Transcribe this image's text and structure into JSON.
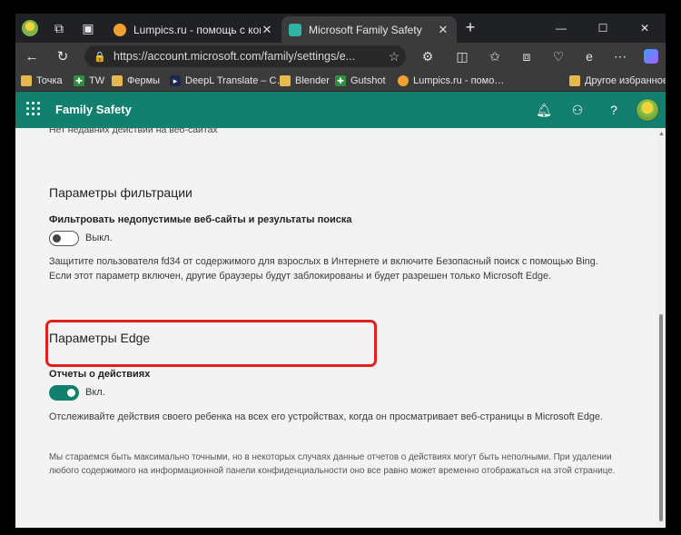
{
  "browser": {
    "tabs": [
      {
        "title": "Lumpics.ru - помощь с компьют…",
        "favicon_color": "#f0a030"
      },
      {
        "title": "Microsoft Family Safety",
        "favicon_color": "#2fb6a3"
      }
    ],
    "new_tab_label": "+",
    "address": "https://account.microsoft.com/family/settings/e...",
    "bookmarks": [
      {
        "label": "Точка",
        "icon": "folder-icon"
      },
      {
        "label": "TW",
        "icon": "bookmark-icon"
      },
      {
        "label": "Фермы",
        "icon": "folder-icon"
      },
      {
        "label": "DeepL Translate – С…",
        "icon": "deepl-icon"
      },
      {
        "label": "Blender",
        "icon": "folder-icon"
      },
      {
        "label": "Gutshot",
        "icon": "bookmark-icon"
      },
      {
        "label": "Lumpics.ru - помо…",
        "icon": "lumpics-icon"
      },
      {
        "label": "Другое избранное",
        "icon": "folder-icon"
      }
    ]
  },
  "app": {
    "title": "Family Safety",
    "accent_color": "#13806f"
  },
  "content": {
    "cut_off_text": "Нет недавних действий на веб-сайтах",
    "filter": {
      "heading": "Параметры фильтрации",
      "label": "Фильтровать недопустимые веб-сайты и результаты поиска",
      "state": "Выкл.",
      "enabled": false,
      "description_line1": "Защитите пользователя fd34 от содержимого для взрослых в Интернете и включите Безопасный поиск с помощью Bing.",
      "description_line2": "Если этот параметр включен, другие браузеры будут заблокированы и будет разрешен только Microsoft Edge."
    },
    "edge": {
      "heading": "Параметры Edge",
      "label": "Отчеты о действиях",
      "state": "Вкл.",
      "enabled": true,
      "description": "Отслеживайте действия своего ребенка на всех его устройствах, когда он просматривает веб-страницы в Microsoft Edge."
    },
    "disclaimer": "Мы стараемся быть максимально точными, но в некоторых случаях данные отчетов о действиях могут быть неполными. При удалении любого содержимого на информационной панели конфиденциальности оно все равно может временно отображаться на этой странице."
  }
}
